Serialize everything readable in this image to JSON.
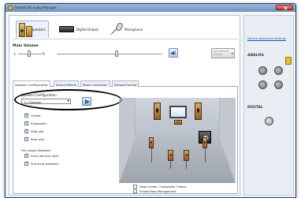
{
  "window": {
    "title": "Realtek HD Audio Manager"
  },
  "device_tabs": [
    {
      "label": "Speakers",
      "icon": "speakers-icon",
      "active": true
    },
    {
      "label": "Digital Output",
      "icon": "digital-output-icon",
      "active": false
    },
    {
      "label": "Microphone",
      "icon": "microphone-icon",
      "active": false
    }
  ],
  "volume": {
    "label": "Main Volume",
    "left_mark": "L",
    "right_mark": "R",
    "balance": 0.5,
    "level": 0.55,
    "set_default_label": "Set Default Device"
  },
  "sub_tabs": [
    {
      "label": "Speaker Configuration",
      "active": true
    },
    {
      "label": "Sound Effects",
      "active": false
    },
    {
      "label": "Room Correction",
      "active": false
    },
    {
      "label": "Default Format",
      "active": false
    }
  ],
  "speaker_config": {
    "label": "Speaker Configuration",
    "selected": "7.1 Speaker",
    "checks": [
      {
        "label": "Center",
        "checked": true
      },
      {
        "label": "Subwoofer",
        "checked": true
      },
      {
        "label": "Side pair",
        "checked": true
      },
      {
        "label": "Rear pair",
        "checked": true
      }
    ],
    "fullrange_label": "Full-range Speakers",
    "fullrange": [
      {
        "label": "Front left and right",
        "checked": true
      },
      {
        "label": "Surround speakers",
        "checked": true
      }
    ],
    "options": [
      {
        "label": "Swap Center / Subwoofer Output",
        "checked": false
      },
      {
        "label": "Enable Bass Management",
        "checked": false
      }
    ]
  },
  "right_panel": {
    "link": "Device advanced settings",
    "analog_label": "ANALOG",
    "digital_label": "DIGITAL"
  }
}
